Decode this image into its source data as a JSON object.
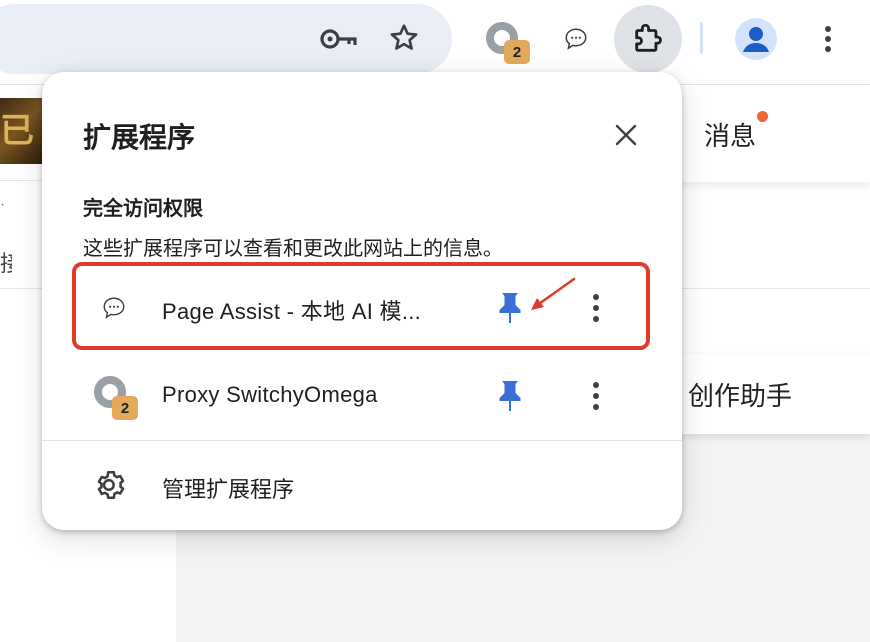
{
  "toolbar": {
    "proxy_badge": "2",
    "icons": [
      "key-icon",
      "star-icon",
      "proxy-icon",
      "chat-bubble-icon",
      "puzzle-icon",
      "avatar-icon",
      "more-vert-icon"
    ]
  },
  "page": {
    "thumb_text": "已初",
    "left_text": "接",
    "messages_label": "消息",
    "assistant_label": "创作助手"
  },
  "popup": {
    "title": "扩展程序",
    "section_title": "完全访问权限",
    "section_desc": "这些扩展程序可以查看和更改此网站上的信息。",
    "extensions": [
      {
        "name": "Page Assist - 本地 AI 模...",
        "icon": "chat-bubble-icon",
        "pinned": true
      },
      {
        "name": "Proxy SwitchyOmega",
        "icon": "proxy-icon",
        "badge": "2",
        "pinned": true
      }
    ],
    "manage_label": "管理扩展程序"
  },
  "colors": {
    "pin": "#3a6fd8",
    "highlight": "#e03a2c",
    "badge": "#e3a85a",
    "notification_dot": "#f0643c"
  }
}
